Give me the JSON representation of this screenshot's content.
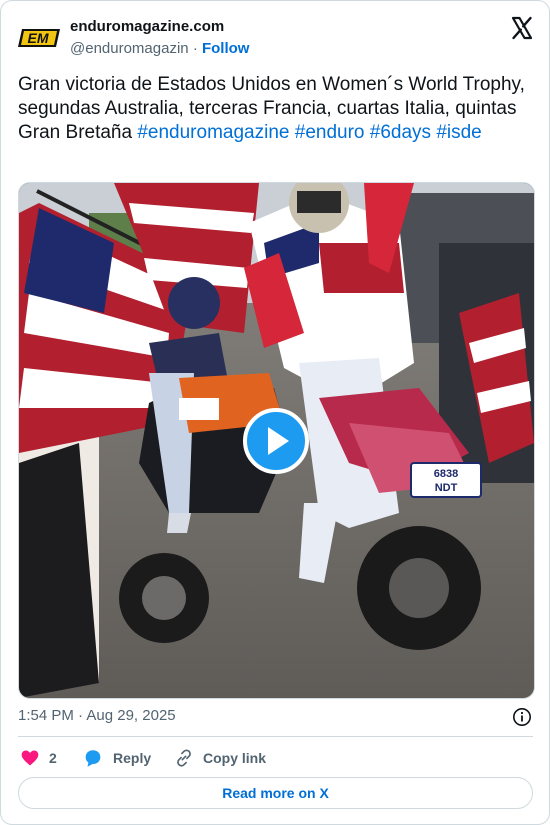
{
  "account": {
    "name": "enduromagazine.com",
    "handle": "@enduromagazin",
    "separator": "·",
    "follow_label": "Follow",
    "logo_text": "EM"
  },
  "tweet": {
    "text": "Gran victoria de Estados Unidos en Women´s World Trophy, segundas Australia, terceras Francia, cuartas Italia, quintas Gran Bretaña ",
    "hashtags": [
      "#enduromagazine",
      "#enduro",
      "#6days",
      "#isde"
    ]
  },
  "media": {
    "type": "video",
    "plates": [
      "6838",
      "NDT"
    ]
  },
  "meta": {
    "time": "1:54 PM",
    "separator": "·",
    "date": "Aug 29, 2025"
  },
  "actions": {
    "like_count": "2",
    "reply_label": "Reply",
    "copy_label": "Copy link"
  },
  "read_more_label": "Read more on X",
  "colors": {
    "accent": "#1d9bf0",
    "link": "#006fd6",
    "like": "#f91880",
    "muted": "#536471",
    "border": "#cfd9de"
  },
  "icons": [
    "em-logo-icon",
    "x-logo-icon",
    "play-icon",
    "info-icon",
    "heart-icon",
    "reply-icon",
    "link-icon"
  ]
}
